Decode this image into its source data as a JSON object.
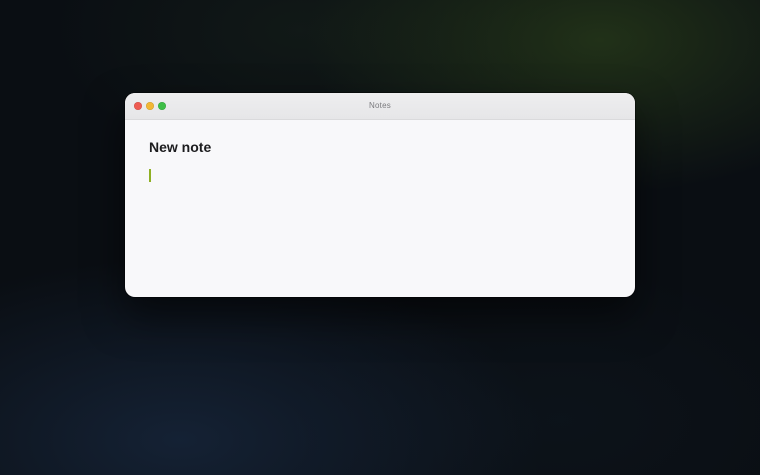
{
  "window": {
    "title": "Notes"
  },
  "note": {
    "title": "New note",
    "body": ""
  },
  "colors": {
    "caret": "#8fb024",
    "close": "#ee5b52",
    "minimize": "#f2b735",
    "zoom": "#3ebe47"
  }
}
